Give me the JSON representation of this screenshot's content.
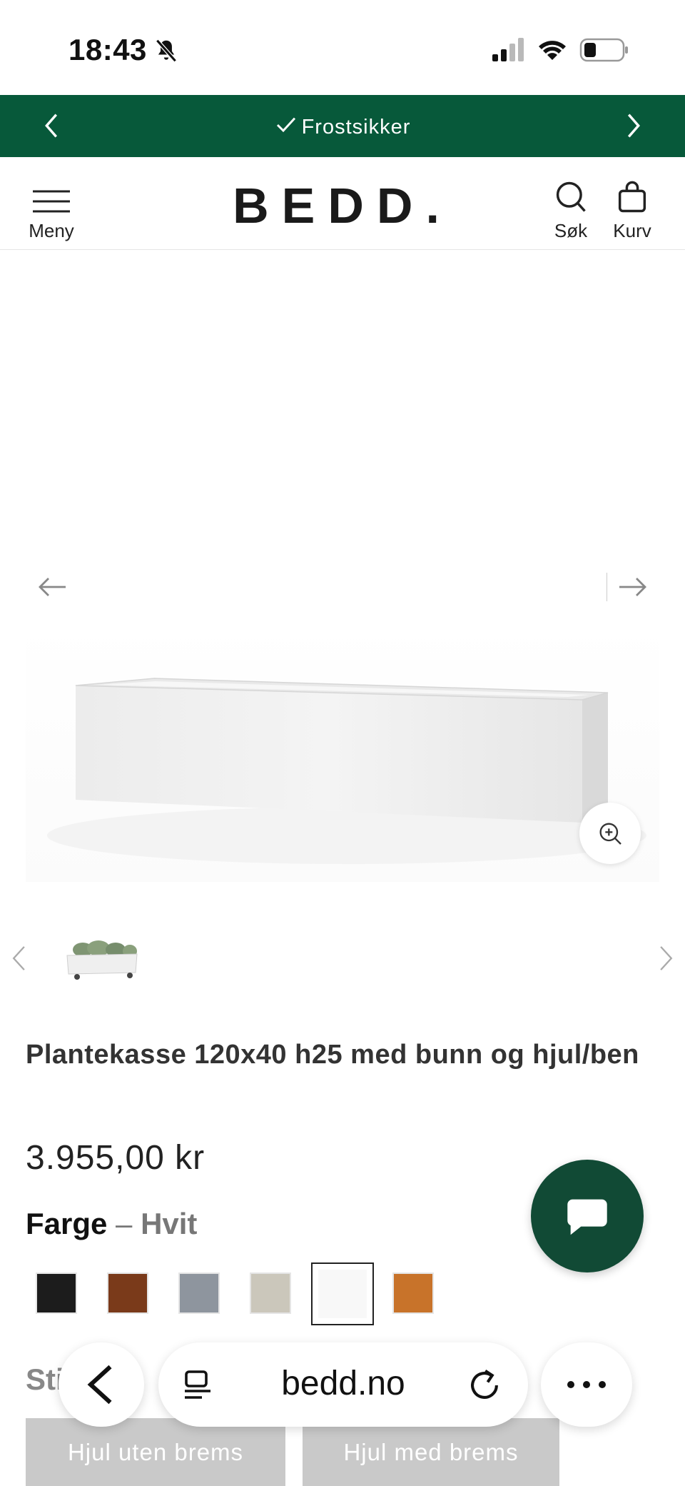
{
  "status_bar": {
    "time": "18:43",
    "icons": [
      "bell-slash-icon",
      "cellular-signal-icon",
      "wifi-icon",
      "battery-icon"
    ]
  },
  "announcement": {
    "message": "Frostsikker",
    "icon": "check-icon",
    "background": "#07593a"
  },
  "header": {
    "menu_label": "Meny",
    "logo": "BEDD.",
    "search_label": "Søk",
    "cart_label": "Kurv"
  },
  "product": {
    "title": "Plantekasse 120x40 h25 med bunn og hjul/ben",
    "price": "3.955,00 kr",
    "color_label": "Farge",
    "color_separator": "–",
    "color_value": "Hvit",
    "swatches": [
      {
        "color": "#1c1c1c",
        "selected": false
      },
      {
        "color": "#7a3a1a",
        "selected": false
      },
      {
        "color": "#8e959e",
        "selected": false
      },
      {
        "color": "#cbc7bb",
        "selected": false
      },
      {
        "color": "#ffffff",
        "selected": true
      },
      {
        "color": "#c8732a",
        "selected": false
      }
    ],
    "style_label": "Sti",
    "options": [
      "Hjul uten brems",
      "Hjul med brems"
    ]
  },
  "browser": {
    "url": "bedd.no"
  },
  "colors": {
    "brand_green": "#07593a",
    "chat_green": "#114a35"
  }
}
